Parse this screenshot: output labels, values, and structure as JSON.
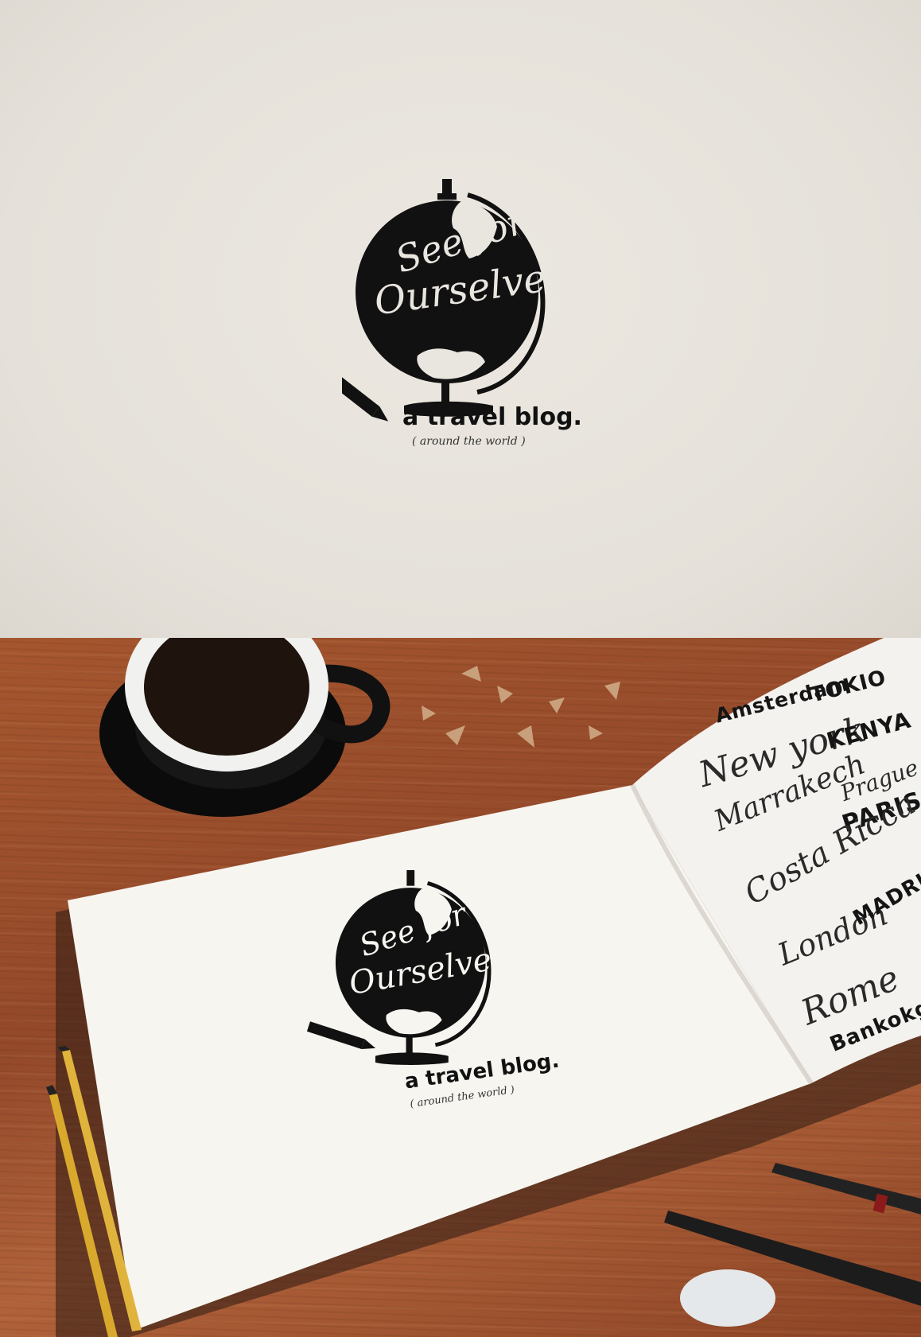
{
  "logo": {
    "title_line1": "See for",
    "title_line2": "Ourselves",
    "tagline": "a travel blog.",
    "subtag": "( around the world )"
  },
  "sketchbook": {
    "cities": [
      {
        "name": "Amsterdam",
        "style": "bold"
      },
      {
        "name": "TOKIO",
        "style": "bold"
      },
      {
        "name": "New york",
        "style": "script"
      },
      {
        "name": "KENYA",
        "style": "bold"
      },
      {
        "name": "Marrakech",
        "style": "script"
      },
      {
        "name": "Prague",
        "style": "script"
      },
      {
        "name": "PARIS",
        "style": "bold"
      },
      {
        "name": "Costa Ricca",
        "style": "script"
      },
      {
        "name": "London",
        "style": "script"
      },
      {
        "name": "MADRID",
        "style": "bold"
      },
      {
        "name": "Rome",
        "style": "script"
      },
      {
        "name": "Bankokg",
        "style": "bold"
      }
    ]
  },
  "colors": {
    "paper": "#e9e5df",
    "ink": "#111111",
    "wood": "#9a4e2b",
    "sketch_page": "#f7f5f0"
  }
}
